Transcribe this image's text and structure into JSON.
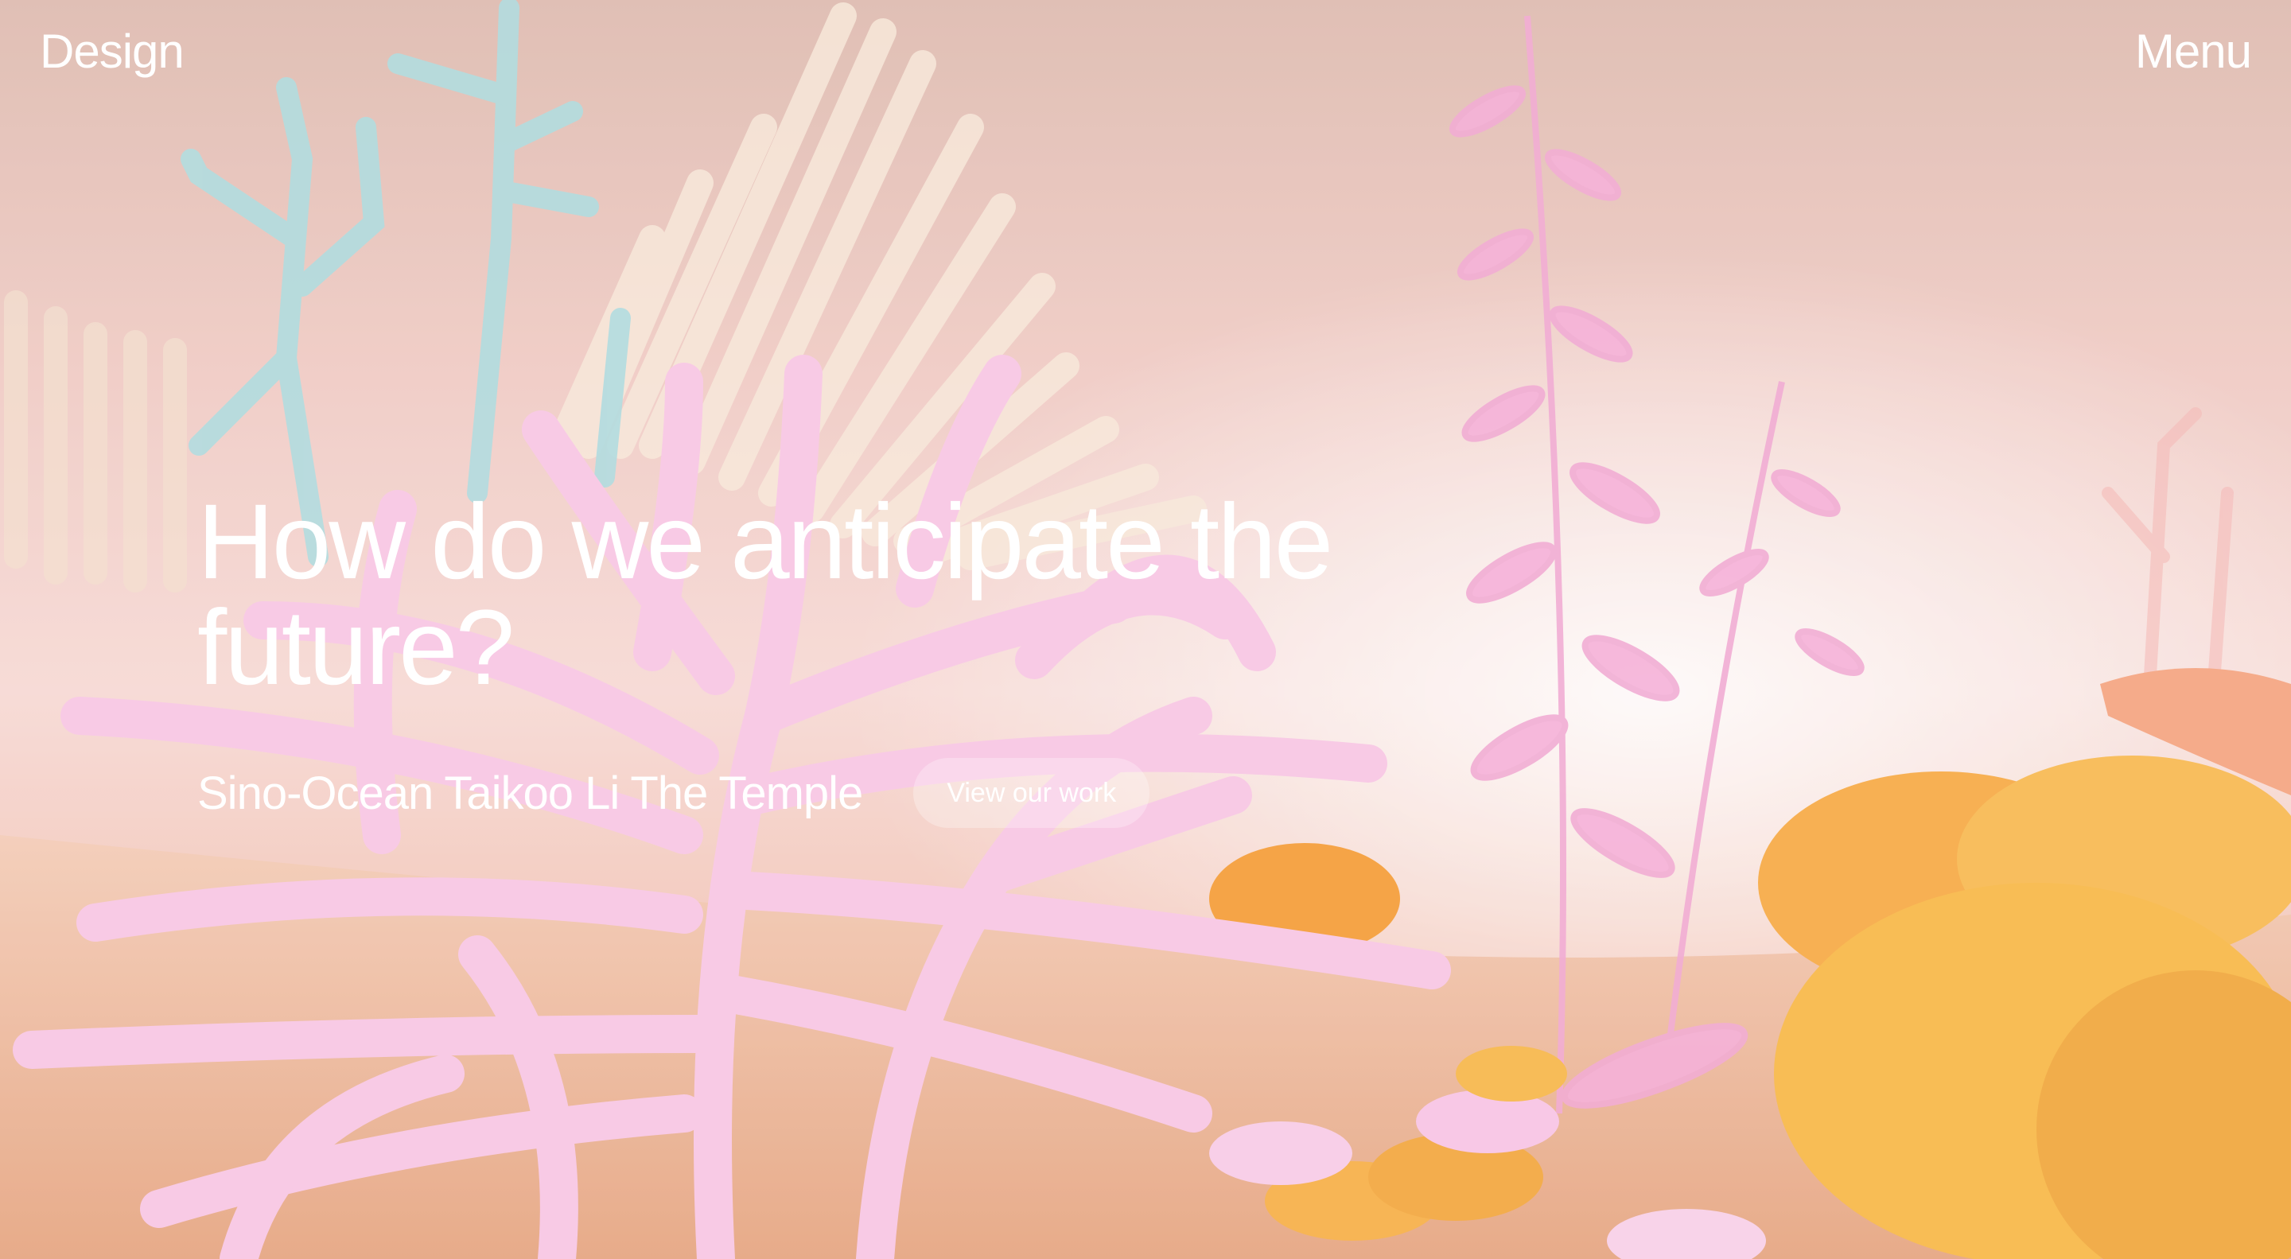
{
  "header": {
    "brand": "Design",
    "menu_label": "Menu"
  },
  "hero": {
    "title": "How do we anticipate the future?",
    "project_name": "Sino-Ocean Taikoo Li The Temple",
    "cta_label": "View our work"
  },
  "background": {
    "description_icon": "coral-reef-scene",
    "colors": {
      "sky": "#efc8c1",
      "sand": "#e9b091",
      "coral_pink": "#f6b4d8",
      "coral_blue": "#a8dbe0",
      "coral_orange": "#f6a43a",
      "coral_cream": "#f8e8d8"
    }
  }
}
